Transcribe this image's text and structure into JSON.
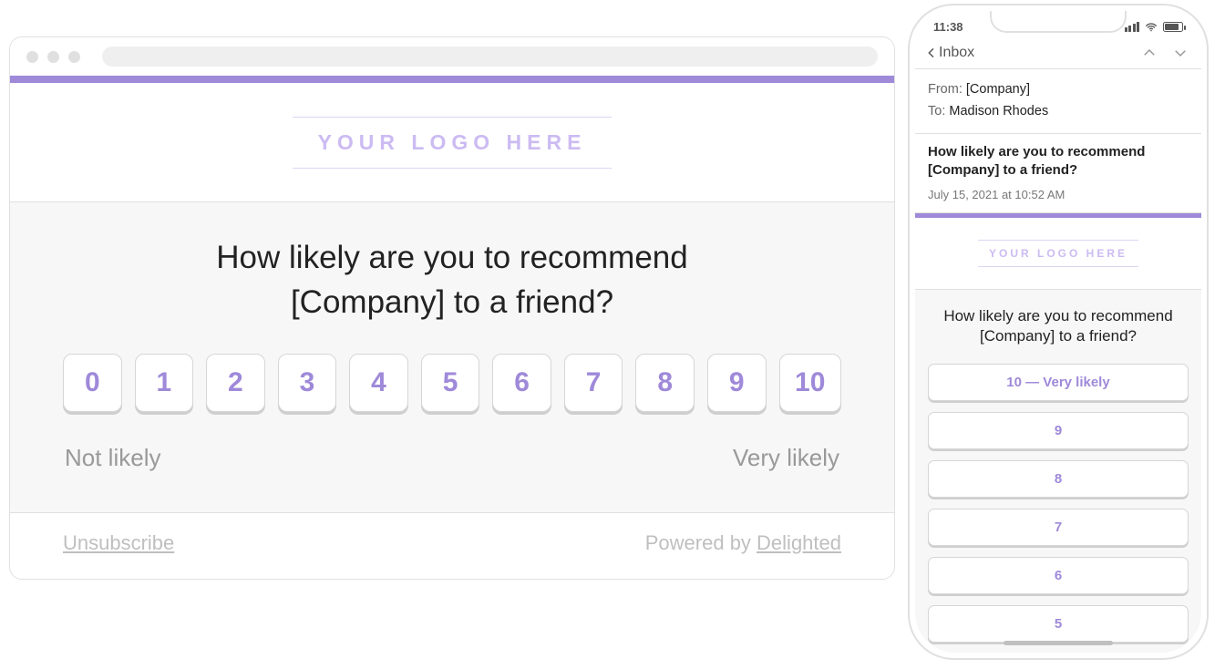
{
  "colors": {
    "accent": "#9f89d9"
  },
  "desktop": {
    "logo_placeholder": "YOUR LOGO HERE",
    "question": "How likely are you to recommend [Company] to a friend?",
    "scores": [
      "0",
      "1",
      "2",
      "3",
      "4",
      "5",
      "6",
      "7",
      "8",
      "9",
      "10"
    ],
    "label_low": "Not likely",
    "label_high": "Very likely",
    "unsubscribe": "Unsubscribe",
    "powered_by_prefix": "Powered by ",
    "powered_by_brand": "Delighted"
  },
  "phone": {
    "time": "11:38",
    "inbox_label": "Inbox",
    "meta": {
      "from_prefix": "From: ",
      "from_value": "[Company]",
      "to_prefix": "To: ",
      "to_value": "Madison Rhodes"
    },
    "subject": "How likely are you to recommend [Company] to a friend?",
    "date": "July 15, 2021 at 10:52 AM",
    "logo_placeholder": "YOUR LOGO HERE",
    "question": "How likely are you to recommend [Company] to a friend?",
    "options": [
      "10 — Very likely",
      "9",
      "8",
      "7",
      "6",
      "5"
    ]
  }
}
